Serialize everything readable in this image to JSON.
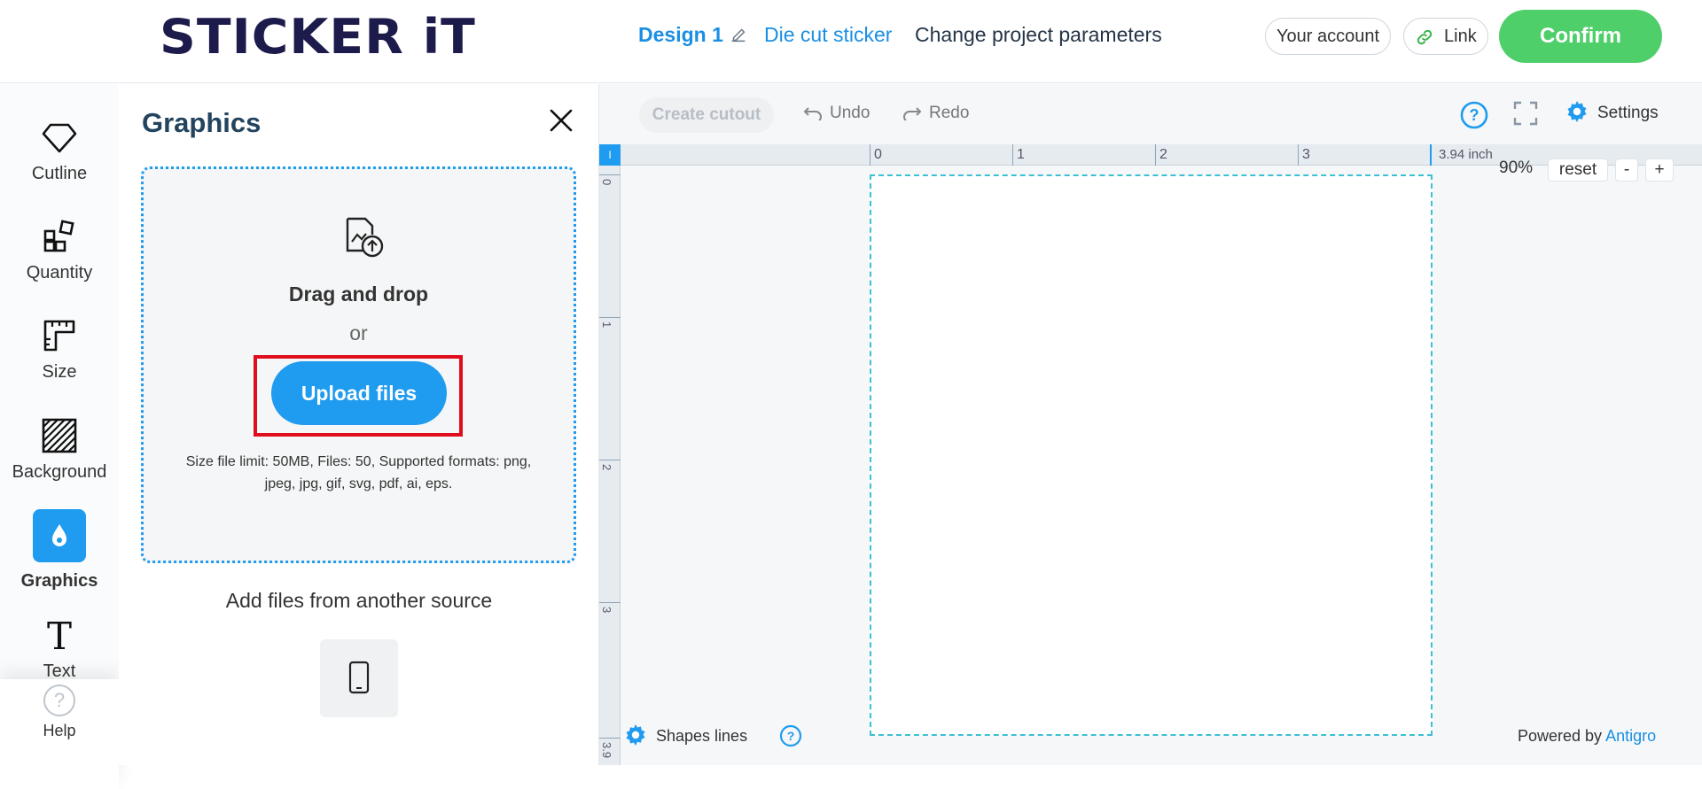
{
  "header": {
    "logo": "STICKER iT",
    "design_name": "Design 1",
    "product": "Die cut sticker",
    "change_params": "Change project parameters",
    "account": "Your account",
    "link": "Link",
    "confirm": "Confirm"
  },
  "sidebar": {
    "items": [
      {
        "label": "Cutline",
        "icon": "diamond-outline-icon"
      },
      {
        "label": "Quantity",
        "icon": "quantity-blocks-icon"
      },
      {
        "label": "Size",
        "icon": "ruler-icon"
      },
      {
        "label": "Background",
        "icon": "hatch-pattern-icon"
      },
      {
        "label": "Graphics",
        "icon": "drop-icon",
        "active": true
      },
      {
        "label": "Text",
        "icon": "text-t-icon"
      }
    ],
    "help": "Help"
  },
  "panel": {
    "title": "Graphics",
    "drag_drop": "Drag and drop",
    "or": "or",
    "upload": "Upload files",
    "limits": "Size file limit: 50MB, Files: 50, Supported formats: png, jpeg, jpg, gif, svg, pdf, ai, eps.",
    "another_source": "Add files from another source"
  },
  "toolbar": {
    "create_cutout": "Create cutout",
    "undo": "Undo",
    "redo": "Redo",
    "settings": "Settings"
  },
  "ruler": {
    "corner": "I",
    "top_ticks": [
      "0",
      "1",
      "2",
      "3"
    ],
    "top_end": "3.94 inch",
    "left_ticks": [
      "0",
      "1",
      "2",
      "3",
      "3.9"
    ]
  },
  "zoom": {
    "value": "90%",
    "reset": "reset",
    "minus": "-",
    "plus": "+"
  },
  "footer": {
    "shapes_lines": "Shapes lines",
    "powered_prefix": "Powered by",
    "powered_brand": "Antigro"
  },
  "colors": {
    "accent": "#1f9bf0",
    "confirm": "#4fcf6a",
    "highlight": "#e00d1d",
    "canvas_border": "#3cc0d3"
  }
}
